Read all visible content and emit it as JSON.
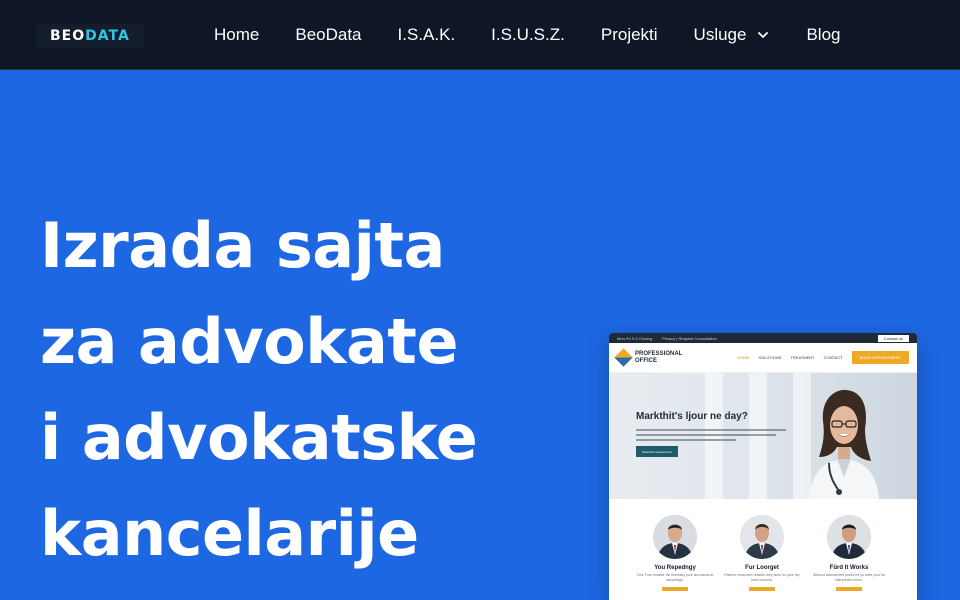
{
  "brand": {
    "logo_part1": "BEO",
    "logo_part2": "DATA",
    "accent_color": "#2ec6e6"
  },
  "nav": {
    "items": [
      {
        "label": "Home"
      },
      {
        "label": "BeoData"
      },
      {
        "label": "I.S.A.K."
      },
      {
        "label": "I.S.U.S.Z."
      },
      {
        "label": "Projekti"
      },
      {
        "label": "Usluge",
        "has_dropdown": true,
        "icon": "chevron-down-icon"
      },
      {
        "label": "Blog"
      }
    ]
  },
  "hero": {
    "title_lines": [
      "Izrada sajta",
      "za advokate",
      "i advokatske",
      "kancelarije"
    ],
    "background_color": "#1d67e3"
  },
  "mockup": {
    "topbar_left": "Mon-Fri 9-5 Closing",
    "topbar_mid": "Privacy | Request Consultation",
    "topbar_cta": "Contact us",
    "brand_line1": "PROFESSIONAL",
    "brand_line2": "OFFICE",
    "menu": [
      "HOME",
      "SOLUTIONS",
      "TREATMENT",
      "CONTACT"
    ],
    "menu_button": "BOOK APPOINTMENT",
    "hero_title": "Markthit's ljour ne day?",
    "hero_button": "Read the Assessment",
    "cards": [
      {
        "title": "You Repedngy",
        "text": "Your Fore models. Be thereaby your and assist to advantage."
      },
      {
        "title": "Fur Loorget",
        "text": "Planner measures reliable they work for your top fined courses."
      },
      {
        "title": "Fürd It Works",
        "text": "Without assessment public be yo write your for interpretive forms."
      }
    ]
  }
}
